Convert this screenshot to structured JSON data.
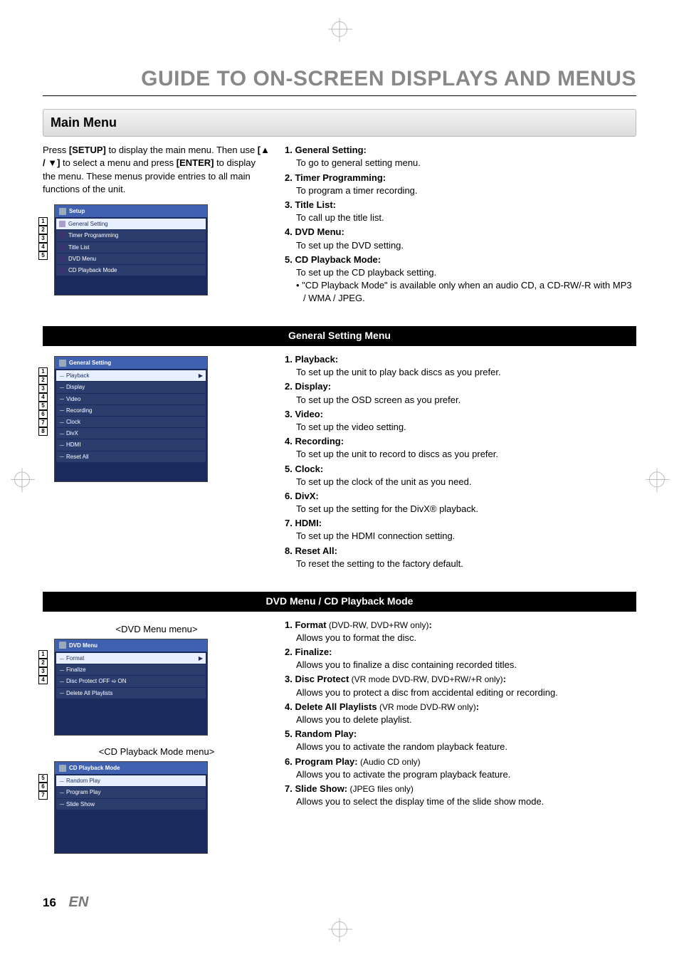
{
  "page": {
    "title": "GUIDE TO ON-SCREEN DISPLAYS AND MENUS",
    "section": "Main Menu",
    "intro_pre": "Press ",
    "intro_key1": "[SETUP]",
    "intro_mid1": " to display the main menu. Then use ",
    "intro_key2": "[▲ / ▼]",
    "intro_mid2": " to select a menu and press ",
    "intro_key3": "[ENTER]",
    "intro_post": " to display the menu. These menus provide entries to all main functions of the unit.",
    "page_number": "16",
    "lang": "EN"
  },
  "osd_main": {
    "title": "Setup",
    "items": [
      "General Setting",
      "Timer Programming",
      "Title List",
      "DVD Menu",
      "CD Playback Mode"
    ],
    "nums": [
      "1",
      "2",
      "3",
      "4",
      "5"
    ]
  },
  "main_defs": [
    {
      "n": "1.",
      "label": "General Setting:",
      "desc": "To go to general setting menu."
    },
    {
      "n": "2.",
      "label": "Timer Programming:",
      "desc": "To program a timer recording."
    },
    {
      "n": "3.",
      "label": "Title List:",
      "desc": "To call up the title list."
    },
    {
      "n": "4.",
      "label": "DVD Menu:",
      "desc": "To set up the DVD setting."
    },
    {
      "n": "5.",
      "label": "CD Playback Mode:",
      "desc": "To set up the CD playback setting.",
      "bullet": "• \"CD Playback Mode\" is available only when an audio CD, a CD-RW/-R with MP3 / WMA / JPEG."
    }
  ],
  "band_gs": "General Setting Menu",
  "osd_gs": {
    "title": "General Setting",
    "items": [
      "Playback",
      "Display",
      "Video",
      "Recording",
      "Clock",
      "DivX",
      "HDMI",
      "Reset All"
    ],
    "nums": [
      "1",
      "2",
      "3",
      "4",
      "5",
      "6",
      "7",
      "8"
    ]
  },
  "gs_defs": [
    {
      "n": "1.",
      "label": "Playback:",
      "desc": "To set up the unit to play back discs as you prefer."
    },
    {
      "n": "2.",
      "label": "Display:",
      "desc": "To set up the OSD screen as you prefer."
    },
    {
      "n": "3.",
      "label": "Video:",
      "desc": "To set up the video setting."
    },
    {
      "n": "4.",
      "label": "Recording:",
      "desc": "To set up the unit to record to discs as you prefer."
    },
    {
      "n": "5.",
      "label": "Clock:",
      "desc": "To set up the clock of the unit as you need."
    },
    {
      "n": "6.",
      "label": "DivX:",
      "desc": "To set up the setting for the DivX® playback."
    },
    {
      "n": "7.",
      "label": "HDMI:",
      "desc": "To set up the HDMI connection setting."
    },
    {
      "n": "8.",
      "label": "Reset All:",
      "desc": "To reset the setting to the factory default."
    }
  ],
  "band_dvd": "DVD Menu / CD Playback Mode",
  "caption_dvd": "<DVD Menu menu>",
  "osd_dvd": {
    "title": "DVD Menu",
    "items": [
      "Format",
      "Finalize",
      "Disc Protect OFF ➯ ON",
      "Delete All Playlists"
    ],
    "nums": [
      "1",
      "2",
      "3",
      "4"
    ]
  },
  "caption_cd": "<CD Playback Mode menu>",
  "osd_cd": {
    "title": "CD Playback Mode",
    "items": [
      "Random Play",
      "Program Play",
      "Slide Show"
    ],
    "nums": [
      "5",
      "6",
      "7"
    ]
  },
  "dvd_defs": [
    {
      "n": "1.",
      "label": "Format",
      "extra": " (DVD-RW, DVD+RW only)",
      "colon": ":",
      "desc": "Allows you to format the disc."
    },
    {
      "n": "2.",
      "label": "Finalize:",
      "desc": "Allows you to finalize a disc containing recorded titles."
    },
    {
      "n": "3.",
      "label": "Disc Protect",
      "extra": " (VR mode DVD-RW, DVD+RW/+R only)",
      "colon": ":",
      "desc": "Allows you to protect a disc from accidental editing or recording."
    },
    {
      "n": "4.",
      "label": "Delete All Playlists",
      "extra": " (VR mode DVD-RW only)",
      "colon": ":",
      "desc": "Allows you to delete playlist."
    },
    {
      "n": "5.",
      "label": "Random Play:",
      "desc": "Allows you to activate the random playback feature."
    },
    {
      "n": "6.",
      "label": "Program Play:",
      "extra2": " (Audio CD only)",
      "desc": "Allows you to activate the program playback feature."
    },
    {
      "n": "7.",
      "label": "Slide Show:",
      "extra2": " (JPEG files only)",
      "desc": "Allows you to select the display time of the slide show mode."
    }
  ]
}
